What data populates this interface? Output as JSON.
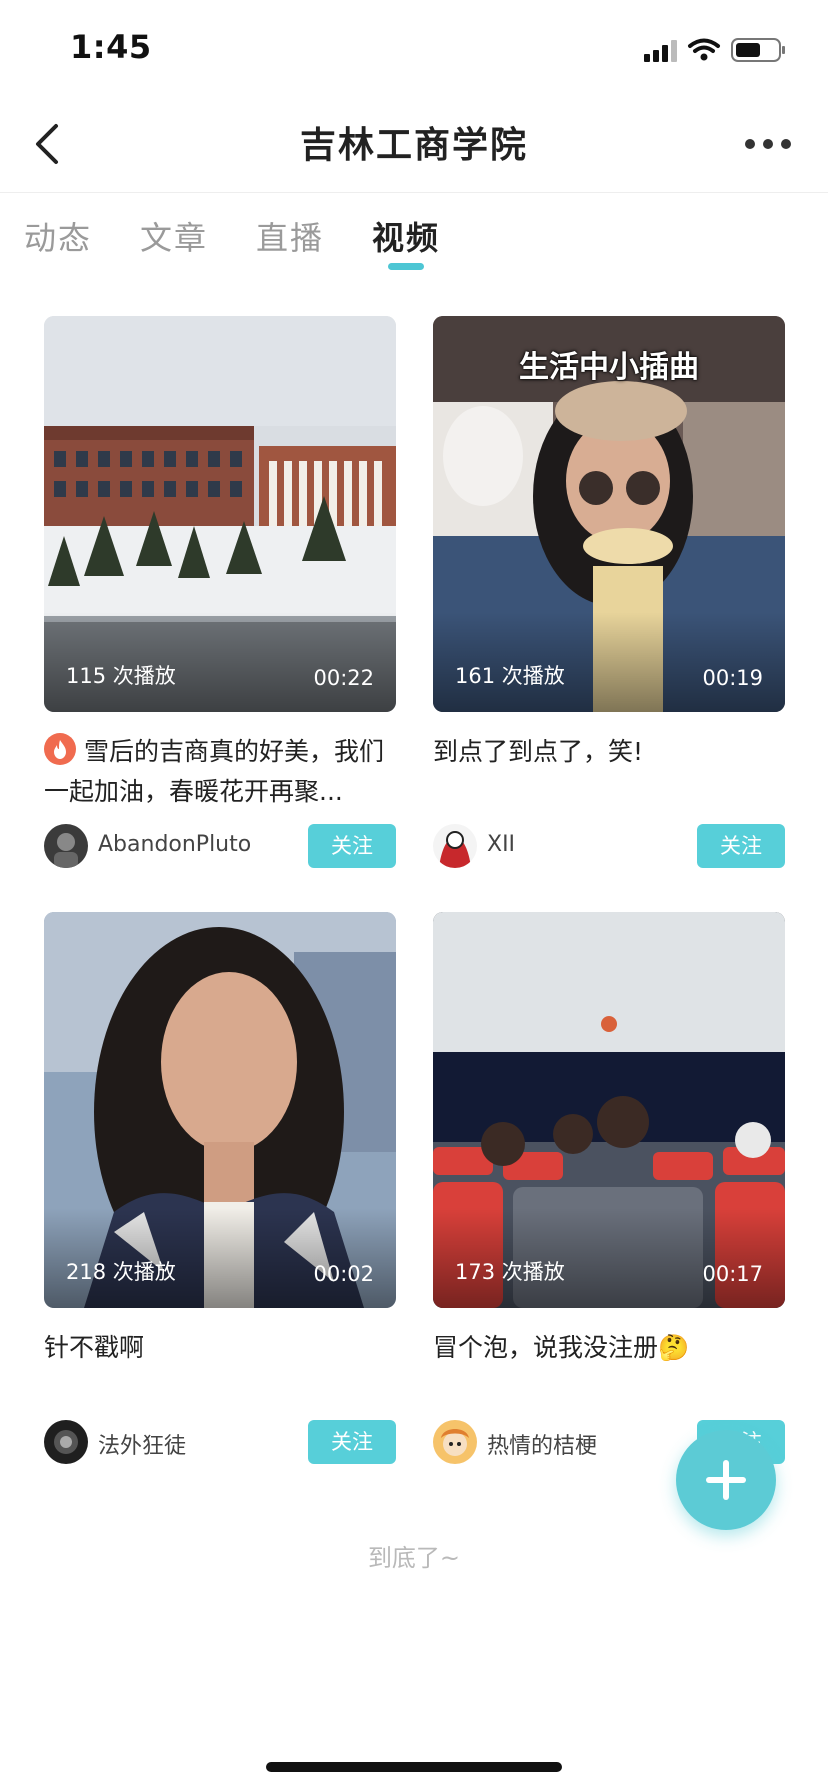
{
  "status_bar": {
    "time": "1:45"
  },
  "nav": {
    "title": "吉林工商学院",
    "back_icon": "chevron-left-icon",
    "more_icon": "more-dots-icon"
  },
  "tabs": [
    {
      "label": "动态"
    },
    {
      "label": "文章"
    },
    {
      "label": "直播"
    },
    {
      "label": "视频",
      "active": true
    }
  ],
  "videos": [
    {
      "views": "115 次播放",
      "duration": "00:22",
      "title": "雪后的吉商真的好美，我们一起加油，春暖花开再聚...",
      "has_fire_icon": true,
      "author": "AbandonPluto",
      "follow_label": "关注"
    },
    {
      "overlay_text": "生活中小插曲",
      "views": "161 次播放",
      "duration": "00:19",
      "title": "到点了到点了，笑!",
      "author": "XII",
      "follow_label": "关注"
    },
    {
      "views": "218 次播放",
      "duration": "00:02",
      "title": "针不戳啊",
      "author": "法外狂徒",
      "follow_label": "关注"
    },
    {
      "views": "173 次播放",
      "duration": "00:17",
      "title": "冒个泡，说我没注册🤔",
      "author": "热情的桔梗",
      "follow_label": "关注"
    }
  ],
  "footer": {
    "end_text": "到底了~"
  },
  "colors": {
    "accent": "#57cfd9",
    "fab": "#5ccbd5",
    "tab_inactive": "#9a9a9a"
  }
}
